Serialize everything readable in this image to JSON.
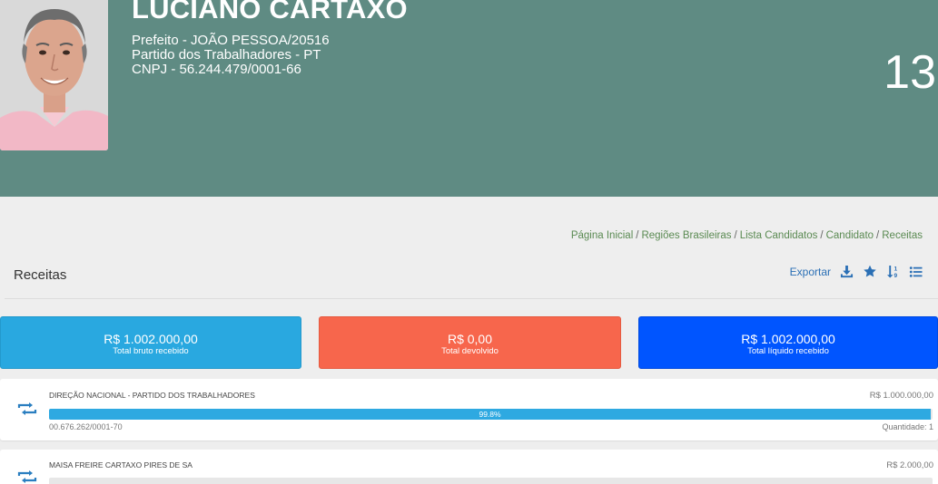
{
  "candidate": {
    "name": "LUCIANO CARTAXO",
    "office_line": "Prefeito - JOÃO PESSOA/20516",
    "party_line": "Partido dos Trabalhadores - PT",
    "cnpj_line": "CNPJ - 56.244.479/0001-66",
    "number": "13"
  },
  "breadcrumb": {
    "items": [
      "Página Inicial",
      "Regiões Brasileiras",
      "Lista Candidatos",
      "Candidato",
      "Receitas"
    ],
    "separator": "/"
  },
  "section": {
    "title": "Receitas",
    "export_label": "Exportar",
    "icons": [
      "download-icon",
      "star-icon",
      "sort-icon",
      "list-icon"
    ]
  },
  "summary": {
    "bruto": {
      "amount": "R$ 1.002.000,00",
      "caption": "Total bruto recebido",
      "color": "#29a8e0"
    },
    "devolvido": {
      "amount": "R$ 0,00",
      "caption": "Total devolvido",
      "color": "#f7664c"
    },
    "liquido": {
      "amount": "R$ 1.002.000,00",
      "caption": "Total líquido recebido",
      "color": "#0055ff"
    }
  },
  "donors": [
    {
      "name": "DIREÇÃO NACIONAL - PARTIDO DOS TRABALHADORES",
      "amount": "R$ 1.000.000,00",
      "percent_label": "99.8%",
      "percent": 99.8,
      "cnpj": "00.676.262/0001-70",
      "quantity": "Quantidade: 1"
    },
    {
      "name": "MAISA FREIRE CARTAXO PIRES DE SA",
      "amount": "R$ 2.000,00"
    }
  ],
  "colors": {
    "header_bg": "#5f8b83",
    "breadcrumb_link": "#5a8a52",
    "accent_blue": "#2a6fb5",
    "progress": "#2ea9e1"
  }
}
